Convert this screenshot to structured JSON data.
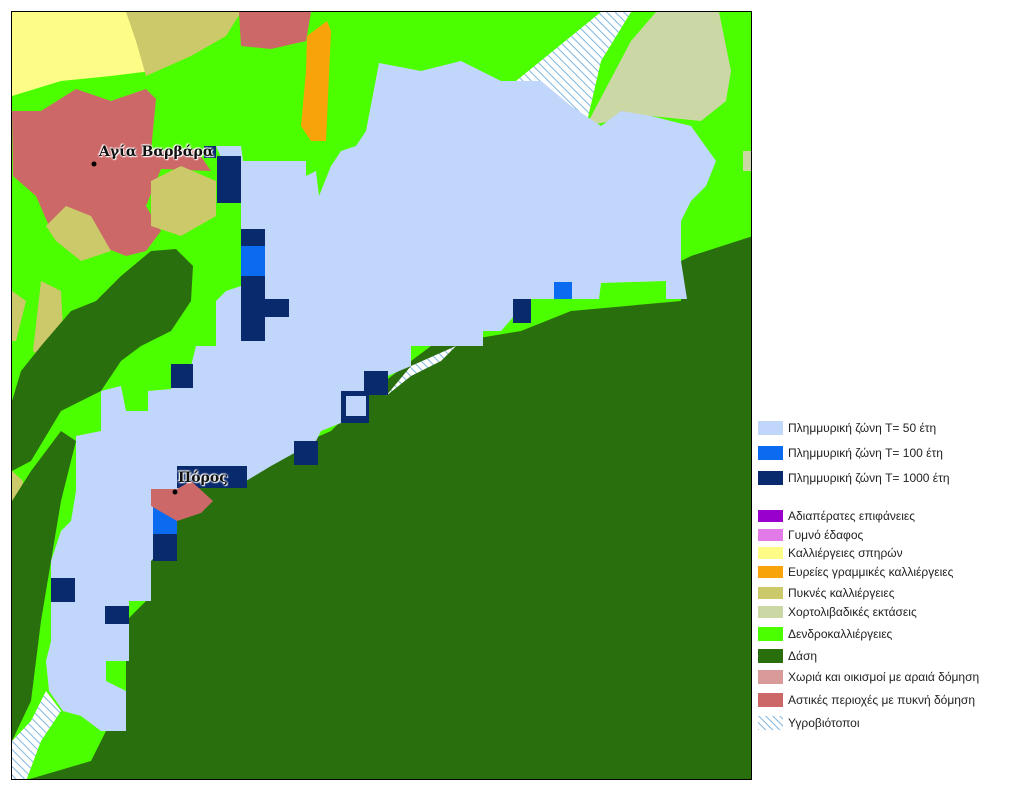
{
  "map": {
    "places": [
      {
        "name": "Αγία Βαρβάρα"
      },
      {
        "name": "Πόρος"
      }
    ]
  },
  "legend": {
    "flood_zones": [
      {
        "label": "Πλημμυρική ζώνη T= 50 έτη",
        "color": "#c1d6fb"
      },
      {
        "label": "Πλημμυρική ζώνη T= 100 έτη",
        "color": "#0a6bf0"
      },
      {
        "label": "Πλημμυρική ζώνη T= 1000 έτη",
        "color": "#0a2a6e"
      }
    ],
    "land_use": [
      {
        "label": "Αδιαπέρατες επιφάνειες",
        "color": "#9a00cc"
      },
      {
        "label": "Γυμνό έδαφος",
        "color": "#e27ae8"
      },
      {
        "label": "Καλλιέργειες σπηρών",
        "color": "#fdfc86"
      },
      {
        "label": "Ευρείες γραμμικές καλλιέργειες",
        "color": "#f8a30a"
      },
      {
        "label": "Πυκνές καλλιέργειες",
        "color": "#cbc96a"
      },
      {
        "label": "Χορτολιβαδικές εκτάσεις",
        "color": "#cbd7a4"
      },
      {
        "label": "Δενδροκαλλιέργειες",
        "color": "#4cff00"
      },
      {
        "label": "Δάση",
        "color": "#2a6f0d"
      },
      {
        "label": "Χωριά και οικισμοί με αραιά δόμηση",
        "color": "#d99a9a"
      },
      {
        "label": "Αστικές περιοχές με πυκνή δόμηση",
        "color": "#cd6868"
      },
      {
        "label": "Υγροβιότοποι",
        "color": "#8fc7e8",
        "pattern": "hatch"
      }
    ]
  }
}
